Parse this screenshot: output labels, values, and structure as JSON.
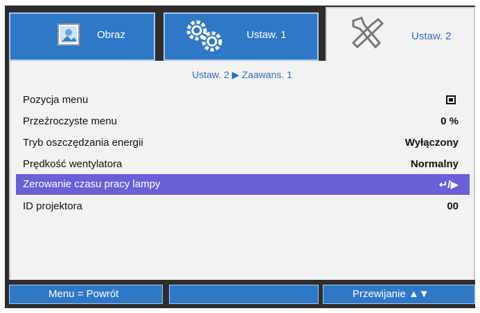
{
  "tabs": [
    {
      "label": "Obraz",
      "icon": "image-icon",
      "active": false
    },
    {
      "label": "Ustaw. 1",
      "icon": "gears-icon",
      "active": false
    },
    {
      "label": "Ustaw. 2",
      "icon": "tools-icon",
      "active": true
    }
  ],
  "breadcrumb": "Ustaw. 2 ▶ Zaawans. 1",
  "rows": [
    {
      "label": "Pozycja menu",
      "value": ""
    },
    {
      "label": "Przeźroczyste menu",
      "value": "0 %"
    },
    {
      "label": "Tryb oszczędzania energii",
      "value": "Wyłączony"
    },
    {
      "label": "Prędkość wentylatora",
      "value": "Normalny"
    },
    {
      "label": "Zerowanie czasu pracy lampy",
      "value": "↵/▶",
      "selected": true
    },
    {
      "label": "ID projektora",
      "value": "00"
    }
  ],
  "footer": {
    "left": "Menu = Powrót",
    "middle": "",
    "right": "Przewijanie ▲▼"
  },
  "colors": {
    "tab_blue": "#2f78c8",
    "highlight": "#6a5fd6",
    "panel": "#f2f2f2",
    "frame": "#2d2d2d",
    "accent_text": "#2d6fbf"
  }
}
